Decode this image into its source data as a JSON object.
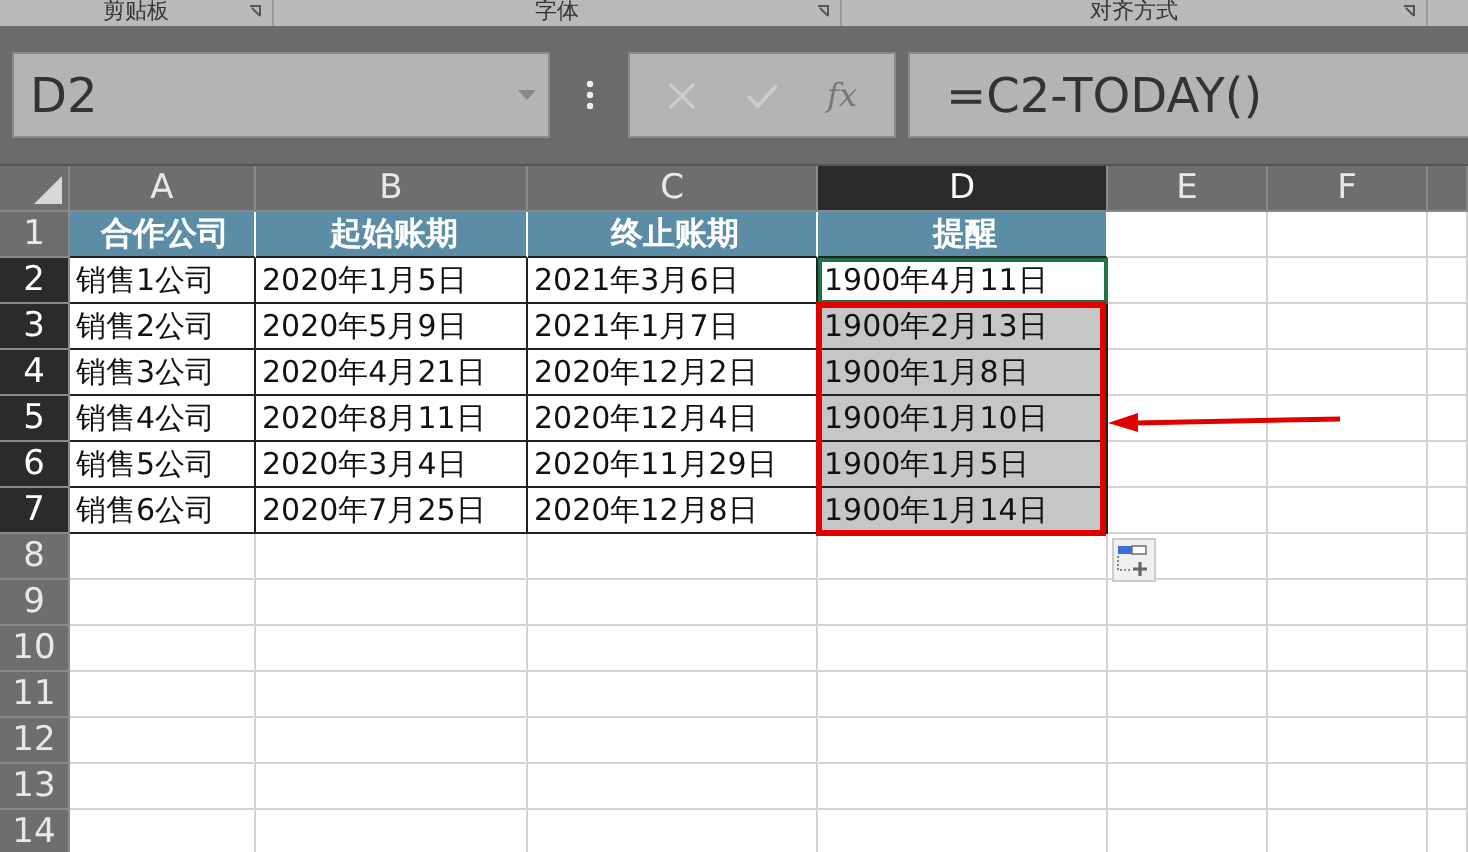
{
  "ribbon_groups": [
    {
      "label": "剪贴板"
    },
    {
      "label": "字体"
    },
    {
      "label": "对齐方式"
    }
  ],
  "formula_bar": {
    "name_box": "D2",
    "function_button": "fx",
    "formula": "=C2-TODAY()"
  },
  "columns": [
    {
      "label": "A",
      "selected": false
    },
    {
      "label": "B",
      "selected": false
    },
    {
      "label": "C",
      "selected": false
    },
    {
      "label": "D",
      "selected": true
    },
    {
      "label": "E",
      "selected": false
    },
    {
      "label": "F",
      "selected": false
    }
  ],
  "rows": [
    {
      "header": "1",
      "kind": "header",
      "selected": false,
      "active": false,
      "cells": [
        "合作公司",
        "起始账期",
        "终止账期",
        "提醒"
      ]
    },
    {
      "header": "2",
      "kind": "data",
      "selected": true,
      "active": true,
      "cells": [
        "销售1公司",
        "2020年1月5日",
        "2021年3月6日",
        "1900年4月11日"
      ]
    },
    {
      "header": "3",
      "kind": "data",
      "selected": true,
      "active": false,
      "cells": [
        "销售2公司",
        "2020年5月9日",
        "2021年1月7日",
        "1900年2月13日"
      ]
    },
    {
      "header": "4",
      "kind": "data",
      "selected": true,
      "active": false,
      "cells": [
        "销售3公司",
        "2020年4月21日",
        "2020年12月2日",
        "1900年1月8日"
      ]
    },
    {
      "header": "5",
      "kind": "data",
      "selected": true,
      "active": false,
      "cells": [
        "销售4公司",
        "2020年8月11日",
        "2020年12月4日",
        "1900年1月10日"
      ]
    },
    {
      "header": "6",
      "kind": "data",
      "selected": true,
      "active": false,
      "cells": [
        "销售5公司",
        "2020年3月4日",
        "2020年11月29日",
        "1900年1月5日"
      ]
    },
    {
      "header": "7",
      "kind": "data",
      "selected": true,
      "active": false,
      "cells": [
        "销售6公司",
        "2020年7月25日",
        "2020年12月8日",
        "1900年1月14日"
      ]
    },
    {
      "header": "8",
      "kind": "empty",
      "selected": false,
      "active": false
    },
    {
      "header": "9",
      "kind": "empty",
      "selected": false,
      "active": false
    },
    {
      "header": "10",
      "kind": "empty",
      "selected": false,
      "active": false
    },
    {
      "header": "11",
      "kind": "empty",
      "selected": false,
      "active": false
    },
    {
      "header": "12",
      "kind": "empty",
      "selected": false,
      "active": false
    },
    {
      "header": "13",
      "kind": "empty",
      "selected": false,
      "active": false
    },
    {
      "header": "14",
      "kind": "empty",
      "selected": false,
      "active": false
    }
  ]
}
